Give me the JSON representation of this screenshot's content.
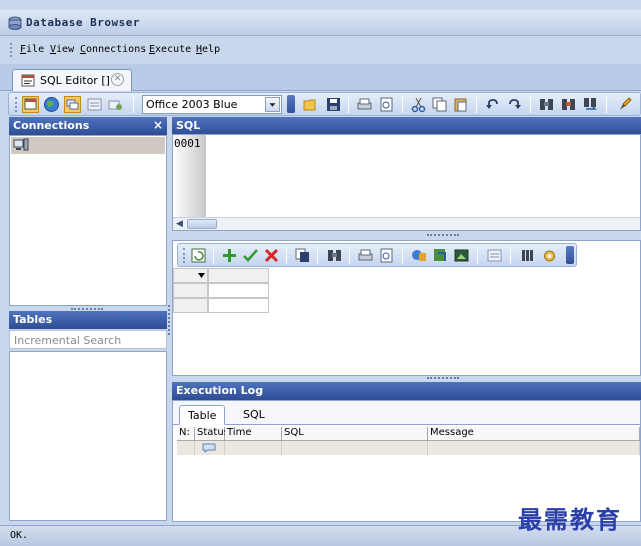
{
  "window": {
    "title": "Database Browser"
  },
  "menu": [
    "File",
    "View",
    "Connections",
    "Execute",
    "Help"
  ],
  "document_tab": {
    "label": "SQL Editor []"
  },
  "toolbar": {
    "theme_selected": "Office 2003 Blue"
  },
  "connections": {
    "header": "Connections",
    "close_glyph": "×"
  },
  "tables": {
    "header": "Tables",
    "search_placeholder": "Incremental Search"
  },
  "sql": {
    "header": "SQL",
    "line_number": "0001"
  },
  "execution_log": {
    "header": "Execution Log",
    "tabs": [
      "Table",
      "SQL"
    ],
    "columns": [
      "N:",
      "Status",
      "Time",
      "SQL",
      "Message"
    ]
  },
  "status": {
    "text": "OK."
  },
  "watermark": "最需教育",
  "colors": {
    "accent": "#2d4c94",
    "panel_header": "#4f73bf",
    "chrome": "#c9d7ec"
  }
}
